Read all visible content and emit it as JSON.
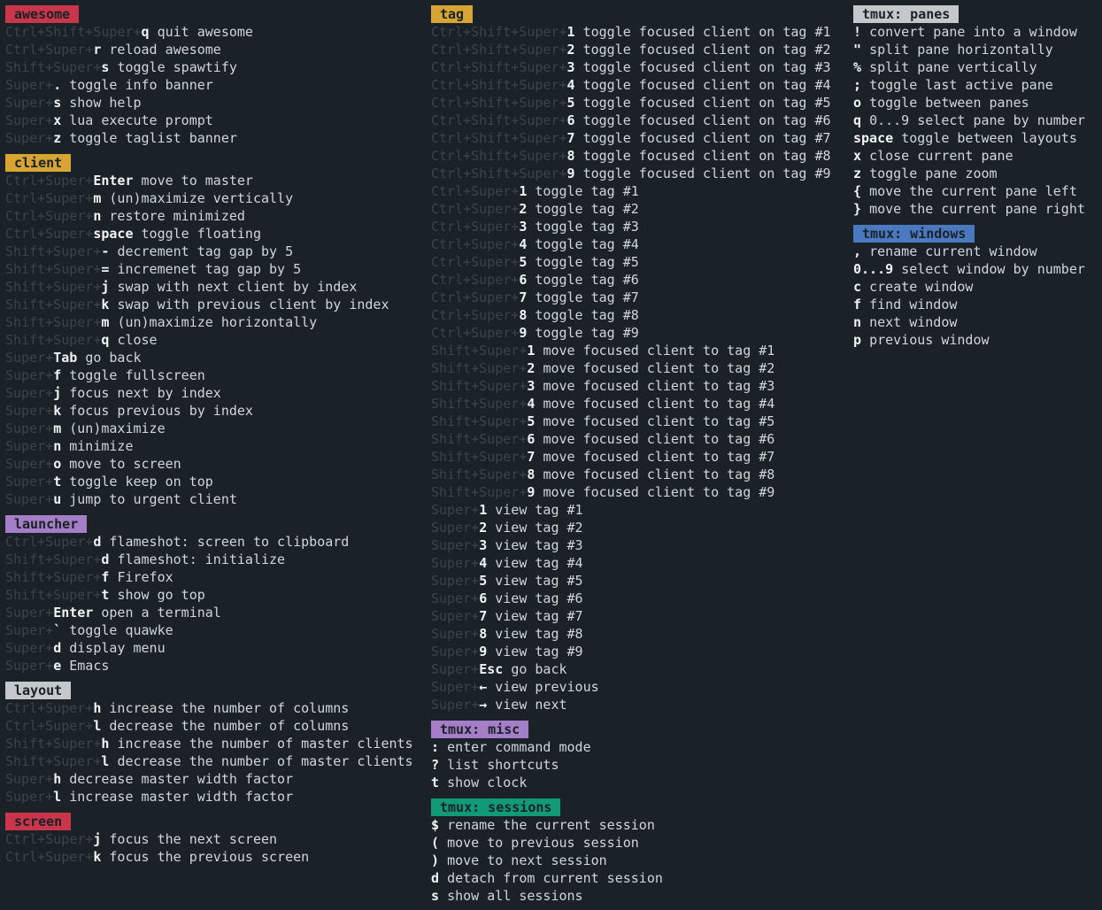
{
  "colors": {
    "background": "#1a2127",
    "text": "#d3d6d8",
    "modifier": "#3a444c",
    "key": "#f2f3f4"
  },
  "columns": [
    {
      "groups": [
        {
          "name": "awesome",
          "header_bg": "#c9364c",
          "header_fg": "#1a2127",
          "rows": [
            {
              "mod": "Ctrl+Shift+Super+",
              "key": "q",
              "desc": "quit awesome"
            },
            {
              "mod": "Ctrl+Super+",
              "key": "r",
              "desc": "reload awesome"
            },
            {
              "mod": "Shift+Super+",
              "key": "s",
              "desc": "toggle spawtify"
            },
            {
              "mod": "Super+",
              "key": ".",
              "desc": "toggle info banner"
            },
            {
              "mod": "Super+",
              "key": "s",
              "desc": "show help"
            },
            {
              "mod": "Super+",
              "key": "x",
              "desc": "lua execute prompt"
            },
            {
              "mod": "Super+",
              "key": "z",
              "desc": "toggle taglist banner"
            }
          ]
        },
        {
          "name": "client",
          "header_bg": "#d6a534",
          "header_fg": "#1a2127",
          "rows": [
            {
              "mod": "Ctrl+Super+",
              "key": "Enter",
              "desc": "move to master"
            },
            {
              "mod": "Ctrl+Super+",
              "key": "m",
              "desc": "(un)maximize vertically"
            },
            {
              "mod": "Ctrl+Super+",
              "key": "n",
              "desc": "restore minimized"
            },
            {
              "mod": "Ctrl+Super+",
              "key": "space",
              "desc": "toggle floating"
            },
            {
              "mod": "Shift+Super+",
              "key": "-",
              "desc": "decrement tag gap by 5"
            },
            {
              "mod": "Shift+Super+",
              "key": "=",
              "desc": "incremenet tag gap by 5"
            },
            {
              "mod": "Shift+Super+",
              "key": "j",
              "desc": "swap with next client by index"
            },
            {
              "mod": "Shift+Super+",
              "key": "k",
              "desc": "swap with previous client by index"
            },
            {
              "mod": "Shift+Super+",
              "key": "m",
              "desc": "(un)maximize horizontally"
            },
            {
              "mod": "Shift+Super+",
              "key": "q",
              "desc": "close"
            },
            {
              "mod": "Super+",
              "key": "Tab",
              "desc": "go back"
            },
            {
              "mod": "Super+",
              "key": "f",
              "desc": "toggle fullscreen"
            },
            {
              "mod": "Super+",
              "key": "j",
              "desc": "focus next by index"
            },
            {
              "mod": "Super+",
              "key": "k",
              "desc": "focus previous by index"
            },
            {
              "mod": "Super+",
              "key": "m",
              "desc": "(un)maximize"
            },
            {
              "mod": "Super+",
              "key": "n",
              "desc": "minimize"
            },
            {
              "mod": "Super+",
              "key": "o",
              "desc": "move to screen"
            },
            {
              "mod": "Super+",
              "key": "t",
              "desc": "toggle keep on top"
            },
            {
              "mod": "Super+",
              "key": "u",
              "desc": "jump to urgent client"
            }
          ]
        },
        {
          "name": "launcher",
          "header_bg": "#a47ec6",
          "header_fg": "#1a2127",
          "rows": [
            {
              "mod": "Ctrl+Super+",
              "key": "d",
              "desc": "flameshot: screen to clipboard"
            },
            {
              "mod": "Shift+Super+",
              "key": "d",
              "desc": "flameshot: initialize"
            },
            {
              "mod": "Shift+Super+",
              "key": "f",
              "desc": "Firefox"
            },
            {
              "mod": "Shift+Super+",
              "key": "t",
              "desc": "show go top"
            },
            {
              "mod": "Super+",
              "key": "Enter",
              "desc": "open a terminal"
            },
            {
              "mod": "Super+",
              "key": "`",
              "desc": "toggle quawke"
            },
            {
              "mod": "Super+",
              "key": "d",
              "desc": "display menu"
            },
            {
              "mod": "Super+",
              "key": "e",
              "desc": "Emacs"
            }
          ]
        },
        {
          "name": "layout",
          "header_bg": "#c4c8cb",
          "header_fg": "#1a2127",
          "rows": [
            {
              "mod": "Ctrl+Super+",
              "key": "h",
              "desc": "increase the number of columns"
            },
            {
              "mod": "Ctrl+Super+",
              "key": "l",
              "desc": "decrease the number of columns"
            },
            {
              "mod": "Shift+Super+",
              "key": "h",
              "desc": "increase the number of master clients"
            },
            {
              "mod": "Shift+Super+",
              "key": "l",
              "desc": "decrease the number of master clients"
            },
            {
              "mod": "Super+",
              "key": "h",
              "desc": "decrease master width factor"
            },
            {
              "mod": "Super+",
              "key": "l",
              "desc": "increase master width factor"
            }
          ]
        },
        {
          "name": "screen",
          "header_bg": "#c9364c",
          "header_fg": "#1a2127",
          "rows": [
            {
              "mod": "Ctrl+Super+",
              "key": "j",
              "desc": "focus the next screen"
            },
            {
              "mod": "Ctrl+Super+",
              "key": "k",
              "desc": "focus the previous screen"
            }
          ]
        }
      ]
    },
    {
      "groups": [
        {
          "name": "tag",
          "header_bg": "#d6a534",
          "header_fg": "#1a2127",
          "rows": [
            {
              "mod": "Ctrl+Shift+Super+",
              "key": "1",
              "desc": "toggle focused client on tag #1"
            },
            {
              "mod": "Ctrl+Shift+Super+",
              "key": "2",
              "desc": "toggle focused client on tag #2"
            },
            {
              "mod": "Ctrl+Shift+Super+",
              "key": "3",
              "desc": "toggle focused client on tag #3"
            },
            {
              "mod": "Ctrl+Shift+Super+",
              "key": "4",
              "desc": "toggle focused client on tag #4"
            },
            {
              "mod": "Ctrl+Shift+Super+",
              "key": "5",
              "desc": "toggle focused client on tag #5"
            },
            {
              "mod": "Ctrl+Shift+Super+",
              "key": "6",
              "desc": "toggle focused client on tag #6"
            },
            {
              "mod": "Ctrl+Shift+Super+",
              "key": "7",
              "desc": "toggle focused client on tag #7"
            },
            {
              "mod": "Ctrl+Shift+Super+",
              "key": "8",
              "desc": "toggle focused client on tag #8"
            },
            {
              "mod": "Ctrl+Shift+Super+",
              "key": "9",
              "desc": "toggle focused client on tag #9"
            },
            {
              "mod": "Ctrl+Super+",
              "key": "1",
              "desc": "toggle tag #1"
            },
            {
              "mod": "Ctrl+Super+",
              "key": "2",
              "desc": "toggle tag #2"
            },
            {
              "mod": "Ctrl+Super+",
              "key": "3",
              "desc": "toggle tag #3"
            },
            {
              "mod": "Ctrl+Super+",
              "key": "4",
              "desc": "toggle tag #4"
            },
            {
              "mod": "Ctrl+Super+",
              "key": "5",
              "desc": "toggle tag #5"
            },
            {
              "mod": "Ctrl+Super+",
              "key": "6",
              "desc": "toggle tag #6"
            },
            {
              "mod": "Ctrl+Super+",
              "key": "7",
              "desc": "toggle tag #7"
            },
            {
              "mod": "Ctrl+Super+",
              "key": "8",
              "desc": "toggle tag #8"
            },
            {
              "mod": "Ctrl+Super+",
              "key": "9",
              "desc": "toggle tag #9"
            },
            {
              "mod": "Shift+Super+",
              "key": "1",
              "desc": "move focused client to tag #1"
            },
            {
              "mod": "Shift+Super+",
              "key": "2",
              "desc": "move focused client to tag #2"
            },
            {
              "mod": "Shift+Super+",
              "key": "3",
              "desc": "move focused client to tag #3"
            },
            {
              "mod": "Shift+Super+",
              "key": "4",
              "desc": "move focused client to tag #4"
            },
            {
              "mod": "Shift+Super+",
              "key": "5",
              "desc": "move focused client to tag #5"
            },
            {
              "mod": "Shift+Super+",
              "key": "6",
              "desc": "move focused client to tag #6"
            },
            {
              "mod": "Shift+Super+",
              "key": "7",
              "desc": "move focused client to tag #7"
            },
            {
              "mod": "Shift+Super+",
              "key": "8",
              "desc": "move focused client to tag #8"
            },
            {
              "mod": "Shift+Super+",
              "key": "9",
              "desc": "move focused client to tag #9"
            },
            {
              "mod": "Super+",
              "key": "1",
              "desc": "view tag #1"
            },
            {
              "mod": "Super+",
              "key": "2",
              "desc": "view tag #2"
            },
            {
              "mod": "Super+",
              "key": "3",
              "desc": "view tag #3"
            },
            {
              "mod": "Super+",
              "key": "4",
              "desc": "view tag #4"
            },
            {
              "mod": "Super+",
              "key": "5",
              "desc": "view tag #5"
            },
            {
              "mod": "Super+",
              "key": "6",
              "desc": "view tag #6"
            },
            {
              "mod": "Super+",
              "key": "7",
              "desc": "view tag #7"
            },
            {
              "mod": "Super+",
              "key": "8",
              "desc": "view tag #8"
            },
            {
              "mod": "Super+",
              "key": "9",
              "desc": "view tag #9"
            },
            {
              "mod": "Super+",
              "key": "Esc",
              "desc": "go back"
            },
            {
              "mod": "Super+",
              "key": "←",
              "desc": "view previous"
            },
            {
              "mod": "Super+",
              "key": "→",
              "desc": "view next"
            }
          ]
        },
        {
          "name": "tmux: misc",
          "header_bg": "#a47ec6",
          "header_fg": "#1a2127",
          "rows": [
            {
              "mod": "",
              "key": ":",
              "desc": "enter command mode"
            },
            {
              "mod": "",
              "key": "?",
              "desc": "list shortcuts"
            },
            {
              "mod": "",
              "key": "t",
              "desc": "show clock"
            }
          ]
        },
        {
          "name": "tmux: sessions",
          "header_bg": "#109a78",
          "header_fg": "#1a2127",
          "rows": [
            {
              "mod": "",
              "key": "$",
              "desc": "rename the current session"
            },
            {
              "mod": "",
              "key": "(",
              "desc": "move to previous session"
            },
            {
              "mod": "",
              "key": ")",
              "desc": "move to next session"
            },
            {
              "mod": "",
              "key": "d",
              "desc": "detach from current session"
            },
            {
              "mod": "",
              "key": "s",
              "desc": "show all sessions"
            }
          ]
        }
      ]
    },
    {
      "groups": [
        {
          "name": "tmux: panes",
          "header_bg": "#c4c8cb",
          "header_fg": "#1a2127",
          "rows": [
            {
              "mod": "",
              "key": "!",
              "desc": "convert pane into a window"
            },
            {
              "mod": "",
              "key": "\"",
              "desc": "split pane horizontally"
            },
            {
              "mod": "",
              "key": "%",
              "desc": "split pane vertically"
            },
            {
              "mod": "",
              "key": ";",
              "desc": "toggle last active pane"
            },
            {
              "mod": "",
              "key": "o",
              "desc": "toggle between panes"
            },
            {
              "mod": "",
              "key": "q",
              "desc": "0...9 select pane by number"
            },
            {
              "mod": "",
              "key": "space",
              "desc": "toggle between layouts"
            },
            {
              "mod": "",
              "key": "x",
              "desc": "close current pane"
            },
            {
              "mod": "",
              "key": "z",
              "desc": "toggle pane zoom"
            },
            {
              "mod": "",
              "key": "{",
              "desc": "move the current pane left"
            },
            {
              "mod": "",
              "key": "}",
              "desc": "move the current pane right"
            }
          ]
        },
        {
          "name": "tmux: windows",
          "header_bg": "#4a79c0",
          "header_fg": "#1a2127",
          "rows": [
            {
              "mod": "",
              "key": ",",
              "desc": "rename current window"
            },
            {
              "mod": "",
              "key": "0...9",
              "desc": "select window by number"
            },
            {
              "mod": "",
              "key": "c",
              "desc": "create window"
            },
            {
              "mod": "",
              "key": "f",
              "desc": "find window"
            },
            {
              "mod": "",
              "key": "n",
              "desc": "next window"
            },
            {
              "mod": "",
              "key": "p",
              "desc": "previous window"
            }
          ]
        }
      ]
    }
  ]
}
